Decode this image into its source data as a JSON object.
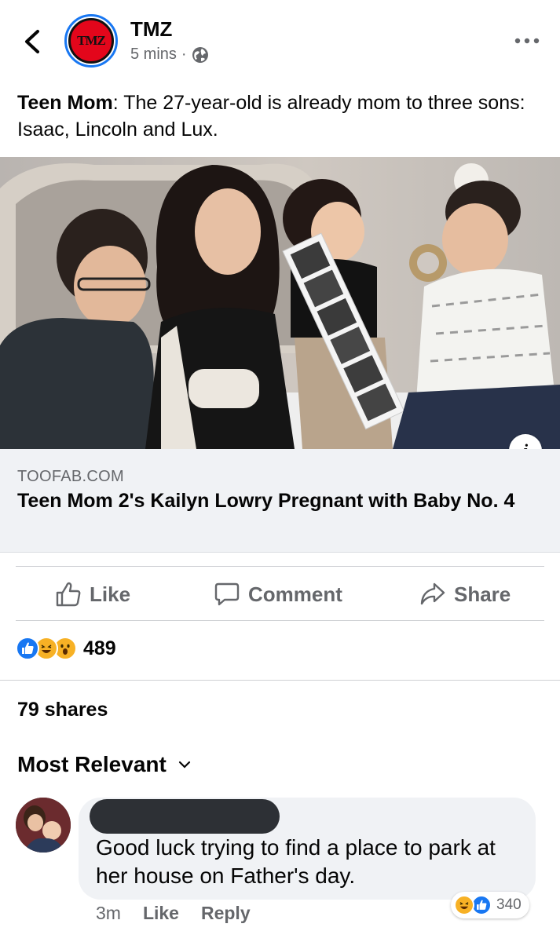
{
  "header": {
    "page_name": "TMZ",
    "avatar_text": "TMZ",
    "timestamp": "5 mins",
    "separator": "·",
    "privacy_icon": "globe-icon",
    "back_icon": "chevron-left-icon",
    "more_icon": "more-horizontal-icon"
  },
  "post": {
    "text_bold": "Teen Mom",
    "text_rest": ": The 27-year-old is already mom to three sons: Isaac, Lincoln and Lux."
  },
  "link": {
    "domain": "TOOFAB.COM",
    "title": "Teen Mom 2's Kailyn Lowry Pregnant with Baby No. 4",
    "info_label": "i"
  },
  "actions": {
    "like_label": "Like",
    "comment_label": "Comment",
    "share_label": "Share"
  },
  "reactions": {
    "types": [
      "like",
      "haha",
      "wow"
    ],
    "count": "489"
  },
  "shares": "79 shares",
  "comments": {
    "sort_label": "Most Relevant",
    "items": [
      {
        "text": "Good luck trying to find a place to park at her house on Father's day.",
        "time": "3m",
        "like_label": "Like",
        "reply_label": "Reply",
        "reaction_types": [
          "haha",
          "like"
        ],
        "reaction_count": "340"
      }
    ]
  },
  "colors": {
    "facebook_blue": "#1877f2",
    "secondary_text": "#65676b",
    "link_bg": "#f0f2f5",
    "tmz_red": "#e3061b"
  }
}
